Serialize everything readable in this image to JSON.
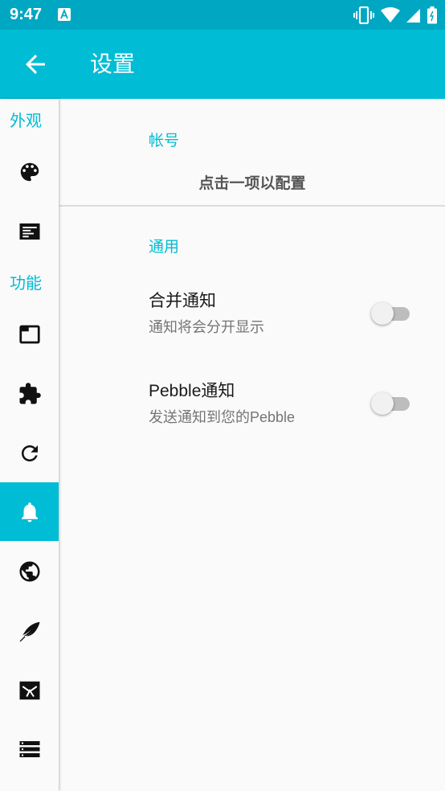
{
  "status": {
    "time": "9:47"
  },
  "appbar": {
    "title": "设置"
  },
  "sidebar": {
    "categories": [
      "外观",
      "功能"
    ],
    "icons": [
      "palette-icon",
      "article-icon",
      "window-icon",
      "extension-icon",
      "refresh-icon",
      "bell-icon",
      "globe-icon",
      "feather-icon",
      "envelope-icon",
      "list-icon"
    ],
    "selected": "bell-icon"
  },
  "content": {
    "accounts": {
      "title": "帐号",
      "hint": "点击一项以配置"
    },
    "general": {
      "title": "通用"
    },
    "prefs": [
      {
        "title": "合并通知",
        "summary": "通知将会分开显示",
        "checked": false
      },
      {
        "title": "Pebble通知",
        "summary": "发送通知到您的Pebble",
        "checked": false
      }
    ]
  },
  "colors": {
    "accent": "#00bcd4",
    "statusbar": "#00a7c3",
    "background": "#fafafa"
  }
}
